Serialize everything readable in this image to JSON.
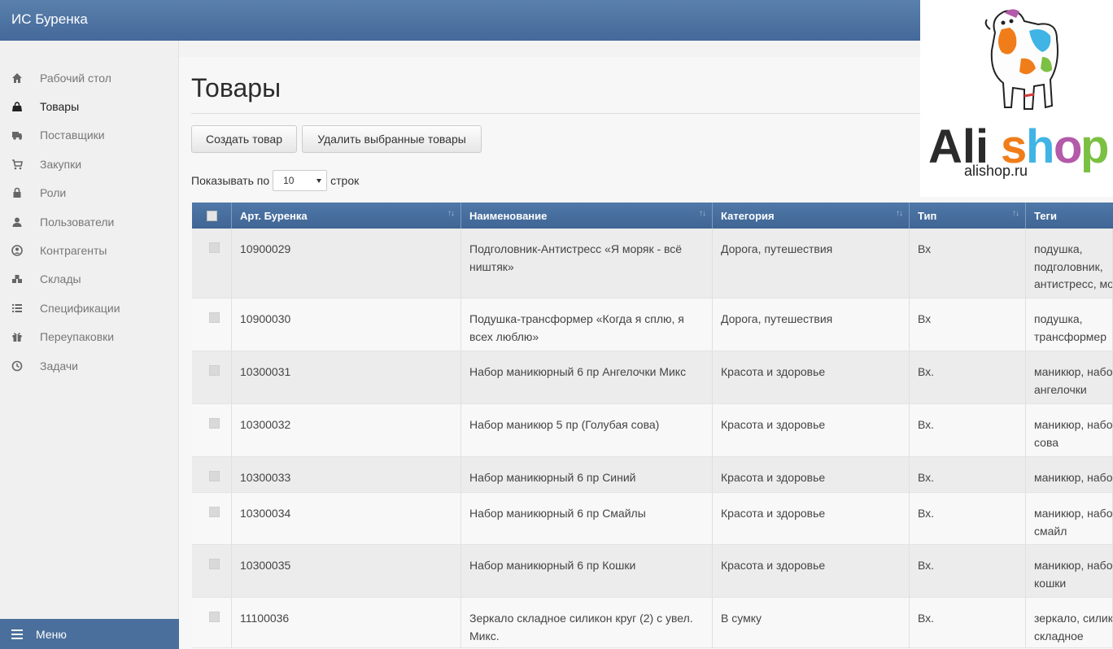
{
  "app": {
    "title": "ИС Буренка"
  },
  "sidebar": {
    "items": [
      {
        "label": "Рабочий стол",
        "icon": "home-icon"
      },
      {
        "label": "Товары",
        "icon": "shopping-bag-icon",
        "active": true
      },
      {
        "label": "Поставщики",
        "icon": "truck-icon"
      },
      {
        "label": "Закупки",
        "icon": "cart-icon"
      },
      {
        "label": "Роли",
        "icon": "lock-icon"
      },
      {
        "label": "Пользователи",
        "icon": "user-icon"
      },
      {
        "label": "Контрагенты",
        "icon": "contact-icon"
      },
      {
        "label": "Склады",
        "icon": "cubes-icon"
      },
      {
        "label": "Спецификации",
        "icon": "list-icon"
      },
      {
        "label": "Переупаковки",
        "icon": "gift-icon"
      },
      {
        "label": "Задачи",
        "icon": "clock-icon"
      }
    ],
    "menu_label": "Меню"
  },
  "page": {
    "title": "Товары",
    "create_button": "Создать товар",
    "delete_button": "Удалить выбранные товары",
    "show_prefix": "Показывать по",
    "page_size": "10",
    "show_suffix": "строк"
  },
  "table": {
    "headers": [
      "Арт. Буренка",
      "Наименование",
      "Категория",
      "Тип",
      "Теги"
    ],
    "rows": [
      {
        "art": "10900029",
        "name": "Подголовник-Антистресс «Я моряк - всё ништяк»",
        "category": "Дорога, путешествия",
        "type": "Вх",
        "tags": [
          "подушка,",
          "подголовник,",
          "антистресс, мо"
        ]
      },
      {
        "art": "10900030",
        "name": "Подушка-трансформер «Когда я сплю, я всех люблю»",
        "category": "Дорога, путешествия",
        "type": "Вх",
        "tags": [
          "подушка,",
          "трансформер"
        ]
      },
      {
        "art": "10300031",
        "name": "Набор маникюрный 6 пр Ангелочки Микс",
        "category": "Красота и здоровье",
        "type": "Вх.",
        "tags": [
          "маникюр, набо",
          "ангелочки"
        ]
      },
      {
        "art": "10300032",
        "name": "Набор маникюр 5 пр (Голубая сова)",
        "category": "Красота и здоровье",
        "type": "Вх.",
        "tags": [
          "маникюр, набо",
          "сова"
        ]
      },
      {
        "art": "10300033",
        "name": "Набор маникюрный 6 пр Синий",
        "category": "Красота и здоровье",
        "type": "Вх.",
        "tags": [
          "маникюр, набо"
        ]
      },
      {
        "art": "10300034",
        "name": "Набор маникюрный 6 пр Смайлы",
        "category": "Красота и здоровье",
        "type": "Вх.",
        "tags": [
          "маникюр, набо",
          "смайл"
        ]
      },
      {
        "art": "10300035",
        "name": "Набор маникюрный 6 пр Кошки",
        "category": "Красота и здоровье",
        "type": "Вх.",
        "tags": [
          "маникюр, набо",
          "кошки"
        ]
      },
      {
        "art": "11100036",
        "name": "Зеркало складное силикон круг (2) с увел. Микс.",
        "category": "В сумку",
        "type": "Вх.",
        "tags": [
          "зеркало, силик",
          "складное"
        ]
      }
    ]
  },
  "logo": {
    "text_ali": "Ali",
    "text_shop": "shop",
    "url": "alishop.ru"
  },
  "colors": {
    "header": "#4a6f9c",
    "accent_orange": "#f07d1a",
    "accent_green": "#7bc043"
  }
}
